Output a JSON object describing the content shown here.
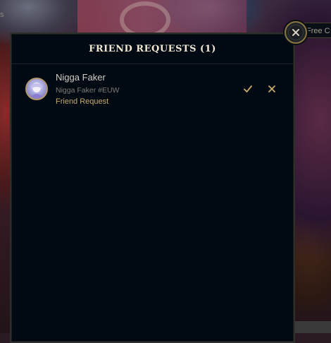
{
  "background": {
    "top_hint": "s",
    "side_tab_text": "Free C"
  },
  "dialog": {
    "title": "FRIEND REQUESTS (1)",
    "close_icon": "close-icon"
  },
  "requests": [
    {
      "name": "Nigga Faker",
      "riot_id": "Nigga Faker #EUW",
      "status": "Friend Request",
      "accept_icon": "checkmark-icon",
      "decline_icon": "x-icon"
    }
  ],
  "colors": {
    "accent_gold": "#c8aa6e",
    "panel_bg": "#010a13",
    "title_text": "#f0e6d2"
  }
}
